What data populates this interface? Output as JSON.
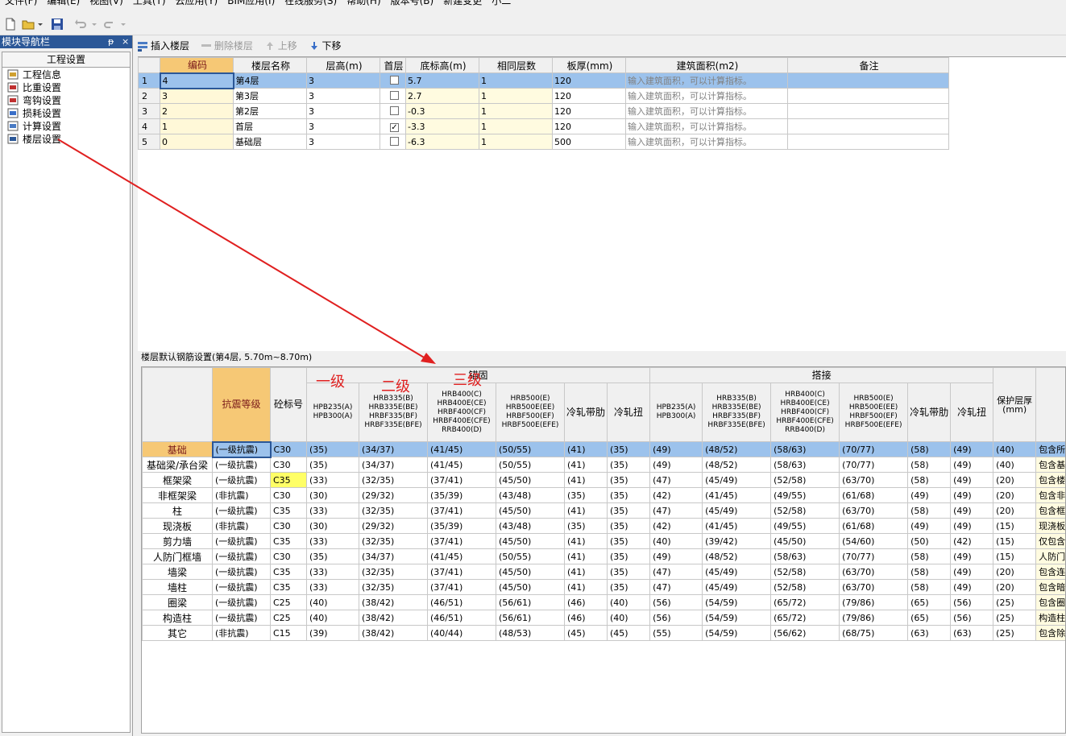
{
  "menu": [
    "文件(F)",
    "编辑(E)",
    "视图(V)",
    "工具(T)",
    "云应用(Y)",
    "BIM应用(I)",
    "在线服务(S)",
    "帮助(H)",
    "版本号(B)",
    "新建变更",
    "小二"
  ],
  "sidebar": {
    "title": "模块导航栏",
    "pin": "ᵽ",
    "close": "×",
    "header": "工程设置",
    "items": [
      {
        "label": "工程信息",
        "icon": "info-icon"
      },
      {
        "label": "比重设置",
        "icon": "weight-icon"
      },
      {
        "label": "弯钩设置",
        "icon": "hook-icon"
      },
      {
        "label": "损耗设置",
        "icon": "loss-icon"
      },
      {
        "label": "计算设置",
        "icon": "calc-icon"
      },
      {
        "label": "楼层设置",
        "icon": "floor-icon"
      }
    ]
  },
  "floor_toolbar": {
    "insert": "插入楼层",
    "delete": "删除楼层",
    "up": "上移",
    "down": "下移"
  },
  "floor_table": {
    "headers": [
      "编码",
      "楼层名称",
      "层高(m)",
      "首层",
      "底标高(m)",
      "相同层数",
      "板厚(mm)",
      "建筑面积(m2)",
      "备注"
    ],
    "rows": [
      {
        "n": "1",
        "code": "4",
        "name": "第4层",
        "height": "3",
        "first": false,
        "base": "5.7",
        "same": "1",
        "slab": "120",
        "area": "输入建筑面积，可以计算指标。",
        "note": ""
      },
      {
        "n": "2",
        "code": "3",
        "name": "第3层",
        "height": "3",
        "first": false,
        "base": "2.7",
        "same": "1",
        "slab": "120",
        "area": "输入建筑面积，可以计算指标。",
        "note": ""
      },
      {
        "n": "3",
        "code": "2",
        "name": "第2层",
        "height": "3",
        "first": false,
        "base": "-0.3",
        "same": "1",
        "slab": "120",
        "area": "输入建筑面积，可以计算指标。",
        "note": ""
      },
      {
        "n": "4",
        "code": "1",
        "name": "首层",
        "height": "3",
        "first": true,
        "base": "-3.3",
        "same": "1",
        "slab": "120",
        "area": "输入建筑面积，可以计算指标。",
        "note": ""
      },
      {
        "n": "5",
        "code": "0",
        "name": "基础层",
        "height": "3",
        "first": false,
        "base": "-6.3",
        "same": "1",
        "slab": "500",
        "area": "输入建筑面积，可以计算指标。",
        "note": ""
      }
    ]
  },
  "rebar": {
    "title": "楼层默认钢筋设置(第4层, 5.70m~8.70m)",
    "group_anchor": "锚固",
    "group_lap": "搭接",
    "h_grade": "抗震等级",
    "h_concrete": "砼标号",
    "h_cols": [
      "HPB235(A)\nHPB300(A)",
      "HRB335(B)\nHRB335E(BE)\nHRBF335(BF)\nHRBF335E(BFE)",
      "HRB400(C)\nHRB400E(CE)\nHRBF400(CF)\nHRBF400E(CFE)\nRRB400(D)",
      "HRB500(E)\nHRB500E(EE)\nHRBF500(EF)\nHRBF500E(EFE)",
      "冷轧带肋",
      "冷轧扭"
    ],
    "h_cover": "保护层厚\n(mm)",
    "rows": [
      {
        "label": "基础",
        "grade": "(一级抗震)",
        "conc": "C30",
        "a": [
          "(35)",
          "(34/37)",
          "(41/45)",
          "(50/55)",
          "(41)",
          "(35)"
        ],
        "l": [
          "(49)",
          "(48/52)",
          "(58/63)",
          "(70/77)",
          "(58)",
          "(49)"
        ],
        "cover": "(40)",
        "desc": "包含所"
      },
      {
        "label": "基础梁/承台梁",
        "grade": "(一级抗震)",
        "conc": "C30",
        "a": [
          "(35)",
          "(34/37)",
          "(41/45)",
          "(50/55)",
          "(41)",
          "(35)"
        ],
        "l": [
          "(49)",
          "(48/52)",
          "(58/63)",
          "(70/77)",
          "(58)",
          "(49)"
        ],
        "cover": "(40)",
        "desc": "包含基"
      },
      {
        "label": "框架梁",
        "grade": "(一级抗震)",
        "conc": "C35",
        "a": [
          "(33)",
          "(32/35)",
          "(37/41)",
          "(45/50)",
          "(41)",
          "(35)"
        ],
        "l": [
          "(47)",
          "(45/49)",
          "(52/58)",
          "(63/70)",
          "(58)",
          "(49)"
        ],
        "cover": "(20)",
        "desc": "包含楼"
      },
      {
        "label": "非框架梁",
        "grade": "(非抗震)",
        "conc": "C30",
        "a": [
          "(30)",
          "(29/32)",
          "(35/39)",
          "(43/48)",
          "(35)",
          "(35)"
        ],
        "l": [
          "(42)",
          "(41/45)",
          "(49/55)",
          "(61/68)",
          "(49)",
          "(49)"
        ],
        "cover": "(20)",
        "desc": "包含非"
      },
      {
        "label": "柱",
        "grade": "(一级抗震)",
        "conc": "C35",
        "a": [
          "(33)",
          "(32/35)",
          "(37/41)",
          "(45/50)",
          "(41)",
          "(35)"
        ],
        "l": [
          "(47)",
          "(45/49)",
          "(52/58)",
          "(63/70)",
          "(58)",
          "(49)"
        ],
        "cover": "(20)",
        "desc": "包含框"
      },
      {
        "label": "现浇板",
        "grade": "(非抗震)",
        "conc": "C30",
        "a": [
          "(30)",
          "(29/32)",
          "(35/39)",
          "(43/48)",
          "(35)",
          "(35)"
        ],
        "l": [
          "(42)",
          "(41/45)",
          "(49/55)",
          "(61/68)",
          "(49)",
          "(49)"
        ],
        "cover": "(15)",
        "desc": "现浇板"
      },
      {
        "label": "剪力墙",
        "grade": "(一级抗震)",
        "conc": "C35",
        "a": [
          "(33)",
          "(32/35)",
          "(37/41)",
          "(45/50)",
          "(41)",
          "(35)"
        ],
        "l": [
          "(40)",
          "(39/42)",
          "(45/50)",
          "(54/60)",
          "(50)",
          "(42)"
        ],
        "cover": "(15)",
        "desc": "仅包含"
      },
      {
        "label": "人防门框墙",
        "grade": "(一级抗震)",
        "conc": "C30",
        "a": [
          "(35)",
          "(34/37)",
          "(41/45)",
          "(50/55)",
          "(41)",
          "(35)"
        ],
        "l": [
          "(49)",
          "(48/52)",
          "(58/63)",
          "(70/77)",
          "(58)",
          "(49)"
        ],
        "cover": "(15)",
        "desc": "人防门"
      },
      {
        "label": "墙梁",
        "grade": "(一级抗震)",
        "conc": "C35",
        "a": [
          "(33)",
          "(32/35)",
          "(37/41)",
          "(45/50)",
          "(41)",
          "(35)"
        ],
        "l": [
          "(47)",
          "(45/49)",
          "(52/58)",
          "(63/70)",
          "(58)",
          "(49)"
        ],
        "cover": "(20)",
        "desc": "包含连"
      },
      {
        "label": "墙柱",
        "grade": "(一级抗震)",
        "conc": "C35",
        "a": [
          "(33)",
          "(32/35)",
          "(37/41)",
          "(45/50)",
          "(41)",
          "(35)"
        ],
        "l": [
          "(47)",
          "(45/49)",
          "(52/58)",
          "(63/70)",
          "(58)",
          "(49)"
        ],
        "cover": "(20)",
        "desc": "包含暗"
      },
      {
        "label": "圈梁",
        "grade": "(一级抗震)",
        "conc": "C25",
        "a": [
          "(40)",
          "(38/42)",
          "(46/51)",
          "(56/61)",
          "(46)",
          "(40)"
        ],
        "l": [
          "(56)",
          "(54/59)",
          "(65/72)",
          "(79/86)",
          "(65)",
          "(56)"
        ],
        "cover": "(25)",
        "desc": "包含圈"
      },
      {
        "label": "构造柱",
        "grade": "(一级抗震)",
        "conc": "C25",
        "a": [
          "(40)",
          "(38/42)",
          "(46/51)",
          "(56/61)",
          "(46)",
          "(40)"
        ],
        "l": [
          "(56)",
          "(54/59)",
          "(65/72)",
          "(79/86)",
          "(65)",
          "(56)"
        ],
        "cover": "(25)",
        "desc": "构造柱"
      },
      {
        "label": "其它",
        "grade": "(非抗震)",
        "conc": "C15",
        "a": [
          "(39)",
          "(38/42)",
          "(40/44)",
          "(48/53)",
          "(45)",
          "(45)"
        ],
        "l": [
          "(55)",
          "(54/59)",
          "(56/62)",
          "(68/75)",
          "(63)",
          "(63)"
        ],
        "cover": "(25)",
        "desc": "包含除"
      }
    ]
  },
  "annotations": [
    "一级",
    "二级",
    "三级"
  ],
  "colors": {
    "selection": "#9cc2ec",
    "header_selected": "#f6c875",
    "annotation": "#e02020",
    "sidebar_title": "#2b5797"
  }
}
